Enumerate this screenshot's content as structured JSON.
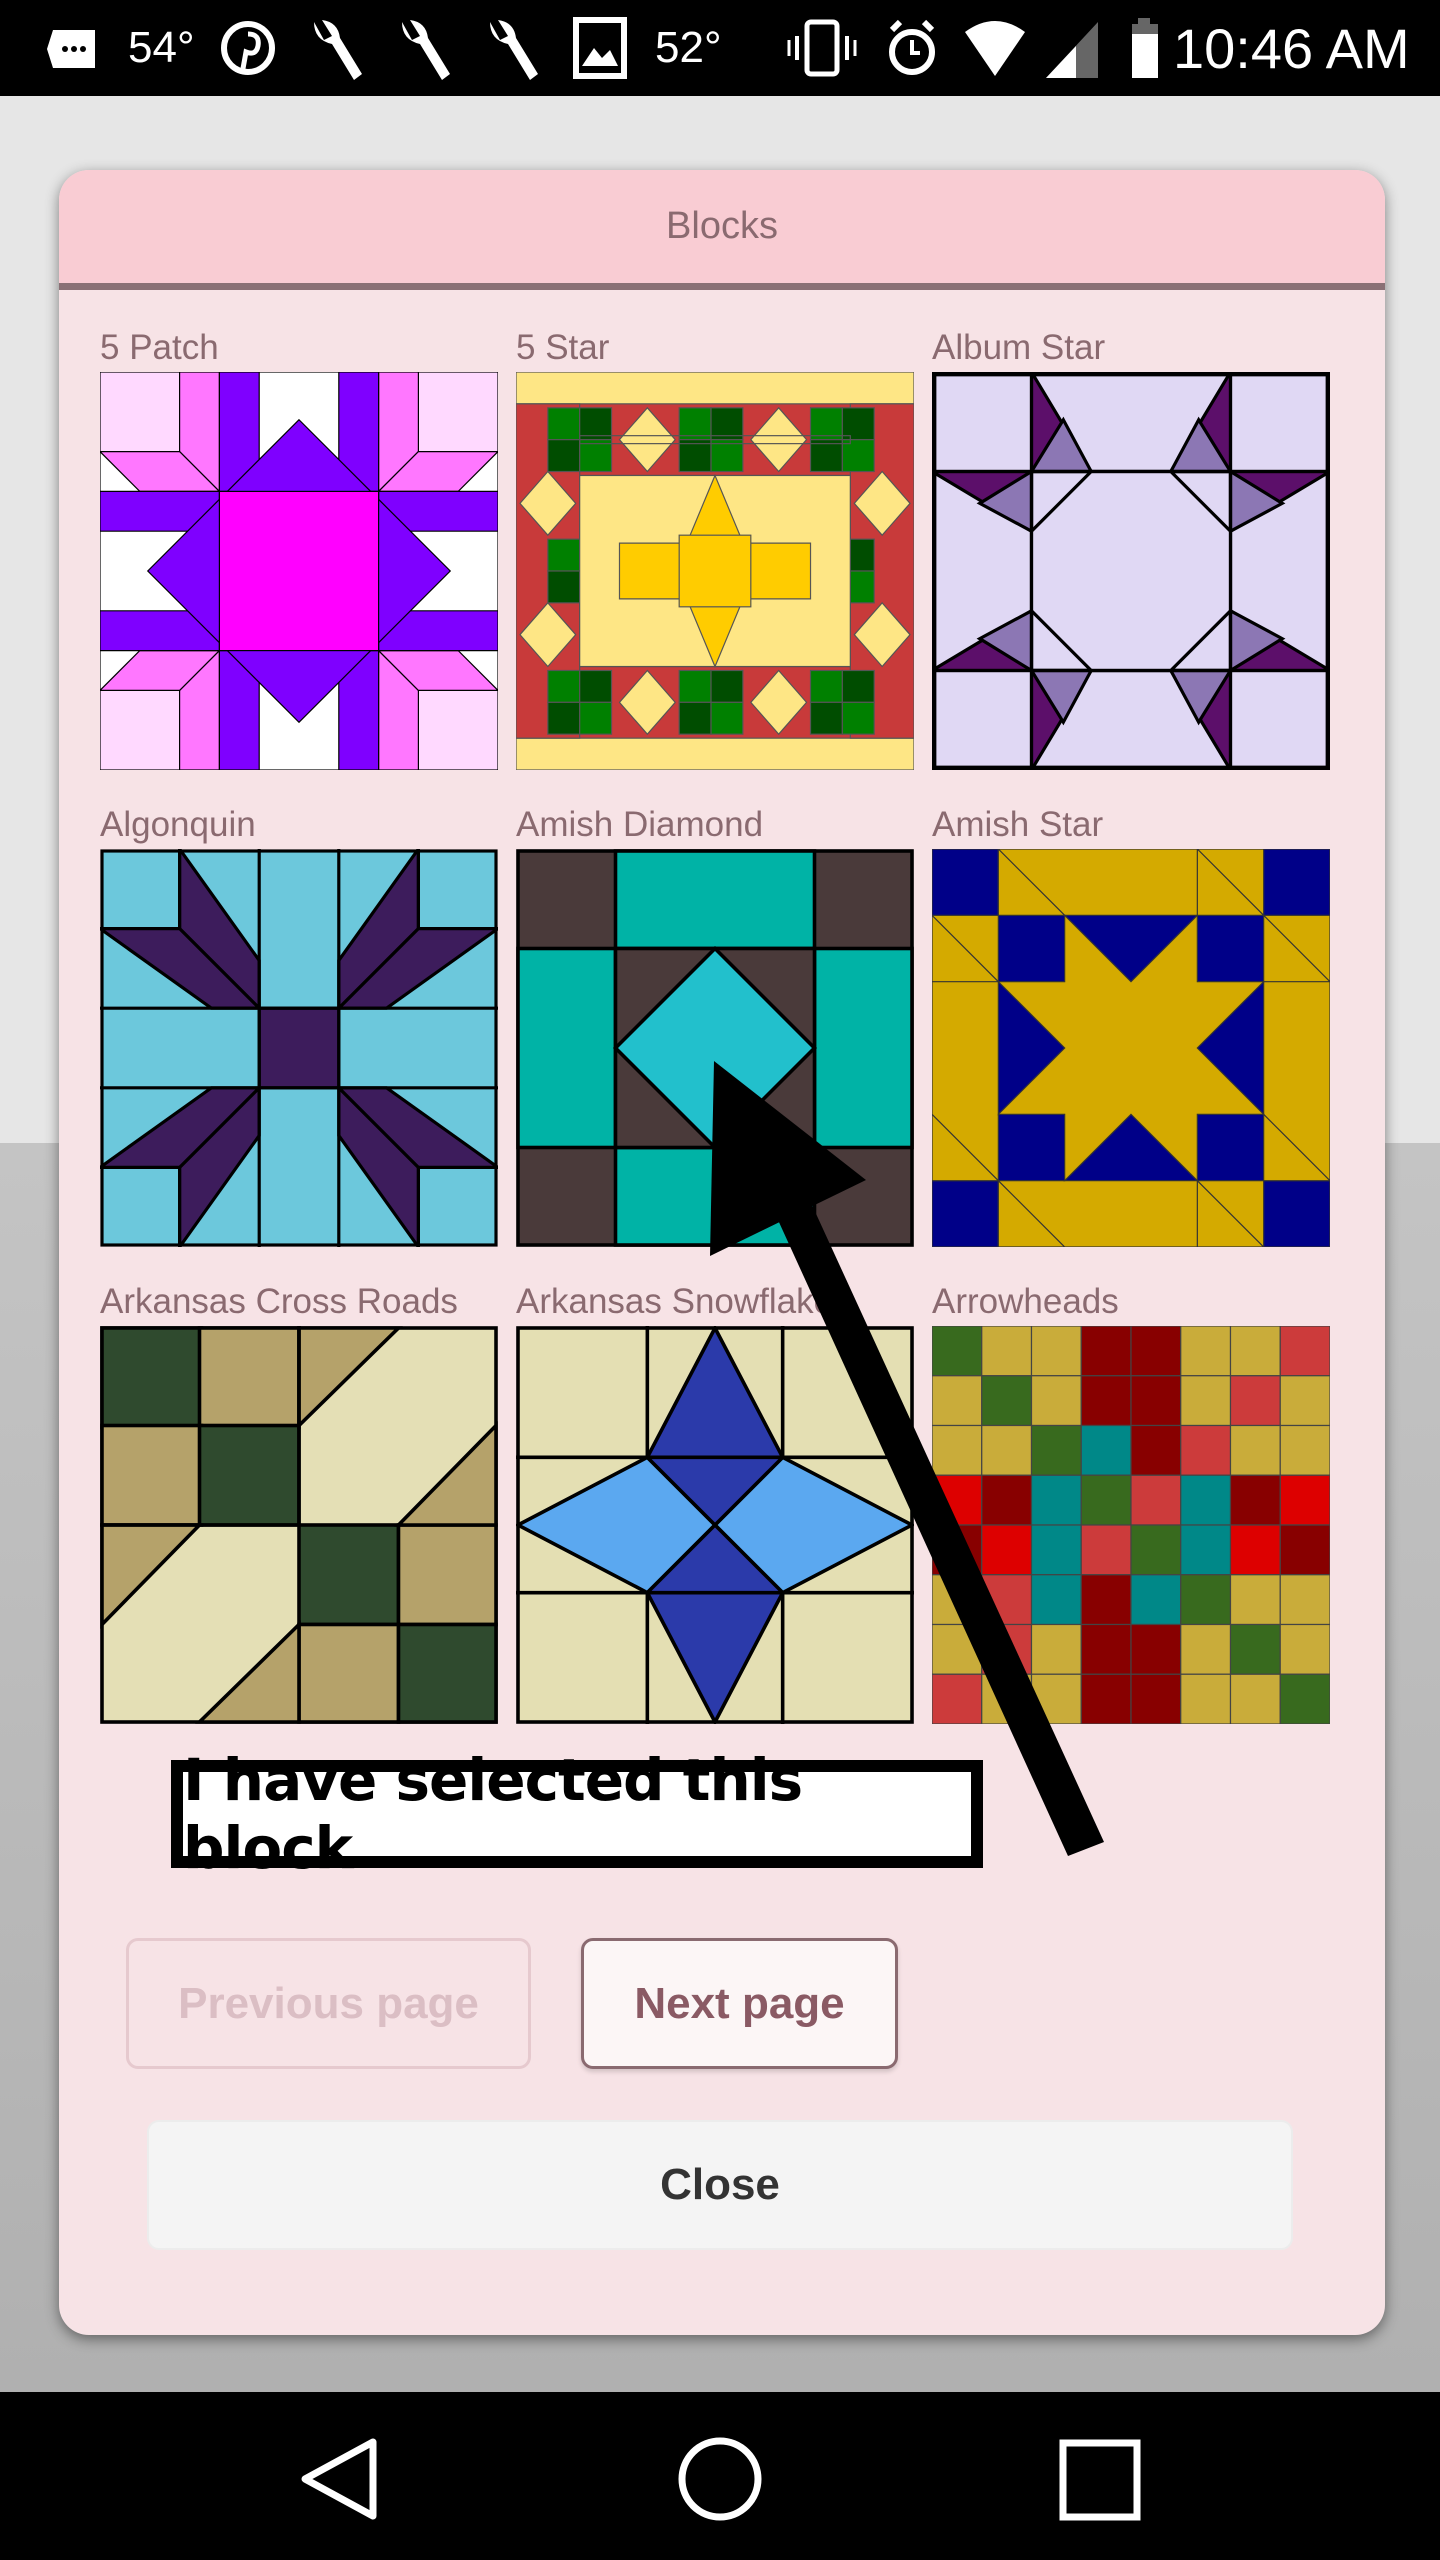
{
  "status_bar": {
    "temp1": "54°",
    "temp2": "52°",
    "time": "10:46 AM",
    "icons": [
      "messages-icon",
      "pinterest-icon",
      "wrench-icon",
      "wrench-icon",
      "wrench-icon",
      "image-icon",
      "vibrate-icon",
      "alarm-icon",
      "wifi-icon",
      "signal-icon",
      "battery-icon"
    ]
  },
  "dialog": {
    "title": "Blocks",
    "blocks": [
      {
        "label": "5 Patch"
      },
      {
        "label": "5 Star"
      },
      {
        "label": "Album Star"
      },
      {
        "label": "Algonquin"
      },
      {
        "label": "Amish Diamond"
      },
      {
        "label": "Amish Star"
      },
      {
        "label": "Arkansas Cross Roads"
      },
      {
        "label": "Arkansas Snowflake"
      },
      {
        "label": "Arrowheads"
      }
    ],
    "annotation": "I have selected this block",
    "previous_label": "Previous page",
    "previous_enabled": false,
    "next_label": "Next page",
    "close_label": "Close"
  },
  "colors": {
    "header": "#f9ccd3",
    "body": "#f7e3e6",
    "accent": "#8a6a70"
  },
  "nav_bar": {
    "icons": [
      "back-icon",
      "home-icon",
      "recents-icon"
    ]
  }
}
